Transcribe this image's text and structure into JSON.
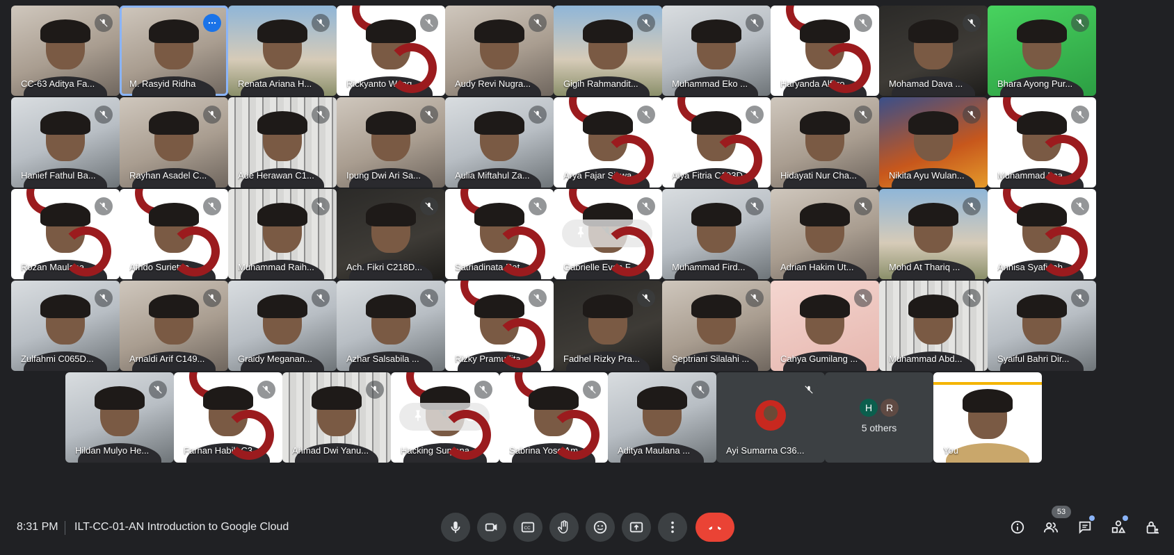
{
  "meeting": {
    "time": "8:31 PM",
    "title": "ILT-CC-01-AN Introduction to Google Cloud",
    "participant_count": "53"
  },
  "row1": [
    "CC-63 Aditya Fa...",
    "M. Rasyid Ridha",
    "Renata Ariana H...",
    "Rickyanto Wang...",
    "Audy Revi Nugra...",
    "Gigih Rahmandit...",
    "Muhammad Eko ...",
    "Haryanda Alfitro...",
    "Mohamad Dava ...",
    "Bhara Ayong Pur..."
  ],
  "row2": [
    "Hanief Fathul Ba...",
    "Rayhan Asadel C...",
    "Ade Herawan C1...",
    "Ipung Dwi Ari Sa...",
    "Aulia Miftahul Za...",
    "Arya Fajar Siswa...",
    "Alya Fitria C193D...",
    "Hidayati Nur Cha...",
    "Nikita Ayu Wulan...",
    "Muhammad Ima..."
  ],
  "row3": [
    "Rozan Maulana ...",
    "Afrido Surietno ...",
    "Muhammad Raih...",
    "Ach. Fikri C218D...",
    "Satriadinata Rat...",
    "Gabrielle Evan F...",
    "Muhammad Fird...",
    "Adrian Hakim Ut...",
    "Mohd At Thariq ...",
    "Annisa Syafiqah ..."
  ],
  "row4": [
    "Zulfahmi C065D...",
    "Arnaldi Arif C149...",
    "Graidy Meganan...",
    "Azhar Salsabila ...",
    "Rizky Pramudita ...",
    "Fadhel Rizky Pra...",
    "Septriani Silalahi ...",
    "Cahya Gumilang ...",
    "Muhammad Abd...",
    "Syaiful Bahri Dir..."
  ],
  "row5": [
    "Hildan Mulyo He...",
    "Farhan Habib C3...",
    "Ahmad Dwi Yanu...",
    "Hacking Suryana...",
    "Sabrina Yose Am...",
    "Aditya Maulana ...",
    "Ayi Sumarna C36..."
  ],
  "others": {
    "initials": [
      "H",
      "R"
    ],
    "initial_colors": [
      "#0b5e4d",
      "#5f4a43"
    ],
    "label": "5 others"
  },
  "self": {
    "label": "You"
  },
  "icons": {
    "mute": "mic-off-icon",
    "more": "more-vert-icon",
    "pin": "pin-icon",
    "remove": "remove-icon"
  },
  "colors": {
    "background": "#202124",
    "control": "#3c4043",
    "end_call": "#ea4335",
    "accent": "#8ab4f8",
    "brand_red": "#9b1b1e"
  }
}
